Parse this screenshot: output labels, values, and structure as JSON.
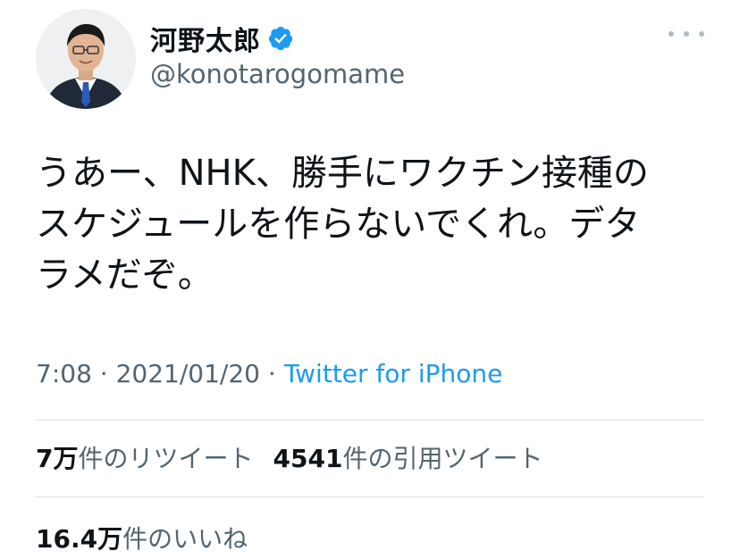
{
  "user": {
    "display_name": "河野太郎",
    "handle": "@konotarogomame",
    "verified": true
  },
  "tweet": {
    "text": "うあー、NHK、勝手にワクチン接種の\nスケジュールを作らないでくれ。デタ\nラメだぞ。",
    "time": "7:08",
    "separator1": " · ",
    "date": "2021/01/20",
    "separator2": " · ",
    "source": "Twitter for iPhone"
  },
  "stats": {
    "retweets_count": "7万",
    "retweets_label": "件のリツイート",
    "quotes_count": "4541",
    "quotes_label": "件の引用ツイート",
    "likes_count": "16.4万",
    "likes_label": "件のいいね"
  },
  "icons": {
    "verified": "verified-badge-icon",
    "more": "more-options-icon"
  },
  "colors": {
    "verified_blue": "#1d9bf0",
    "link_blue": "#1d9bf0",
    "muted_text": "#536471",
    "primary_text": "#0f1419"
  }
}
